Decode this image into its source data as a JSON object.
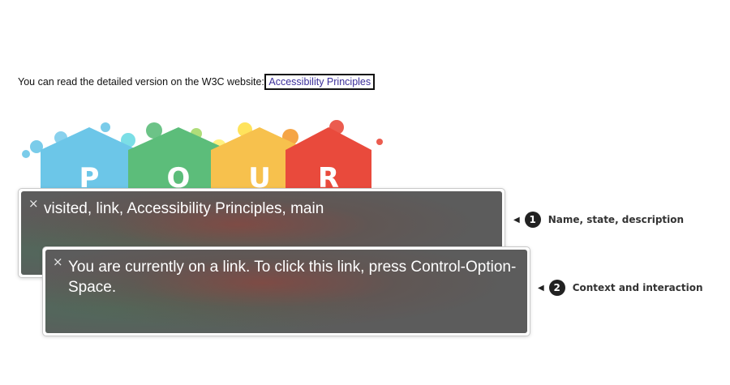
{
  "intro": {
    "text": "You can read the detailed version on the W3C website:",
    "link_label": "Accessibility Principles"
  },
  "logo": {
    "letters": [
      "P",
      "O",
      "U",
      "R"
    ],
    "colors": [
      "#6cc6e8",
      "#5cbd7a",
      "#f7c14d",
      "#e94a3c"
    ]
  },
  "voiceover": {
    "announcement": "visited, link, Accessibility Principles, main",
    "hint": "You are currently on a link. To click this link, press Control-Option-Space.",
    "close_symbol": "×"
  },
  "callouts": [
    {
      "number": "1",
      "label": "Name, state, description"
    },
    {
      "number": "2",
      "label": "Context and interaction"
    }
  ]
}
